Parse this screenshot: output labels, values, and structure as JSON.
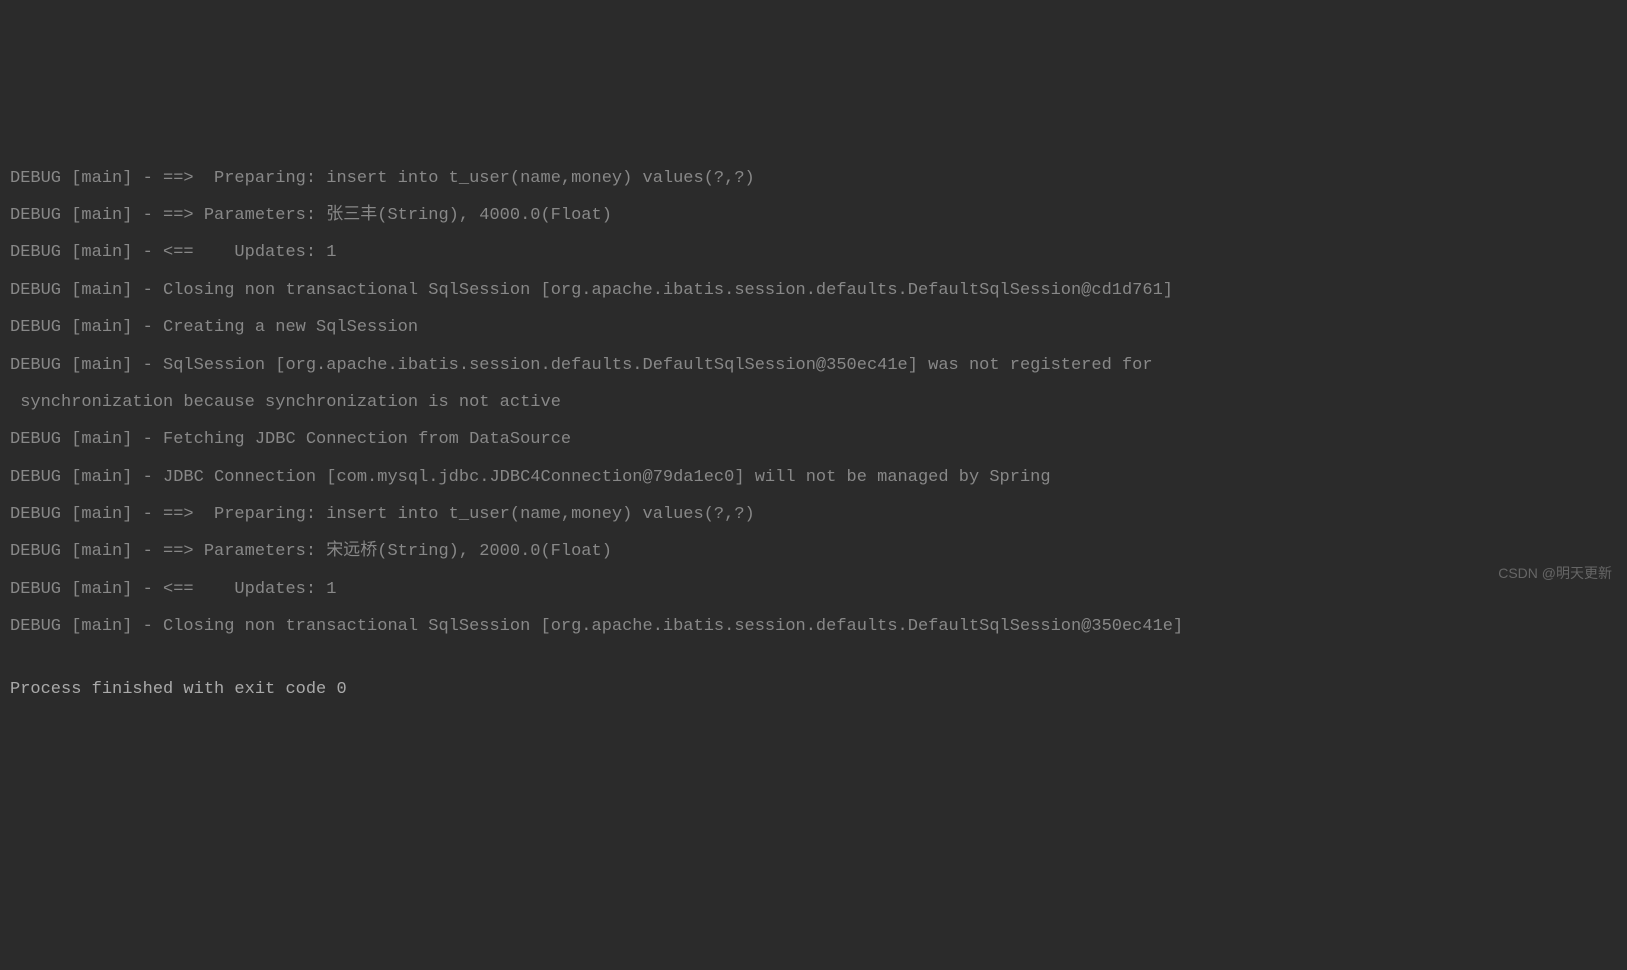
{
  "console": {
    "lines": [
      "DEBUG [main] - ==>  Preparing: insert into t_user(name,money) values(?,?)",
      "DEBUG [main] - ==> Parameters: 张三丰(String), 4000.0(Float)",
      "DEBUG [main] - <==    Updates: 1",
      "DEBUG [main] - Closing non transactional SqlSession [org.apache.ibatis.session.defaults.DefaultSqlSession@cd1d761]",
      "DEBUG [main] - Creating a new SqlSession",
      "DEBUG [main] - SqlSession [org.apache.ibatis.session.defaults.DefaultSqlSession@350ec41e] was not registered for",
      " synchronization because synchronization is not active",
      "DEBUG [main] - Fetching JDBC Connection from DataSource",
      "DEBUG [main] - JDBC Connection [com.mysql.jdbc.JDBC4Connection@79da1ec0] will not be managed by Spring",
      "DEBUG [main] - ==>  Preparing: insert into t_user(name,money) values(?,?)",
      "DEBUG [main] - ==> Parameters: 宋远桥(String), 2000.0(Float)",
      "DEBUG [main] - <==    Updates: 1",
      "DEBUG [main] - Closing non transactional SqlSession [org.apache.ibatis.session.defaults.DefaultSqlSession@350ec41e]"
    ],
    "exit_message": "Process finished with exit code 0"
  },
  "watermark": "CSDN @明天更新"
}
